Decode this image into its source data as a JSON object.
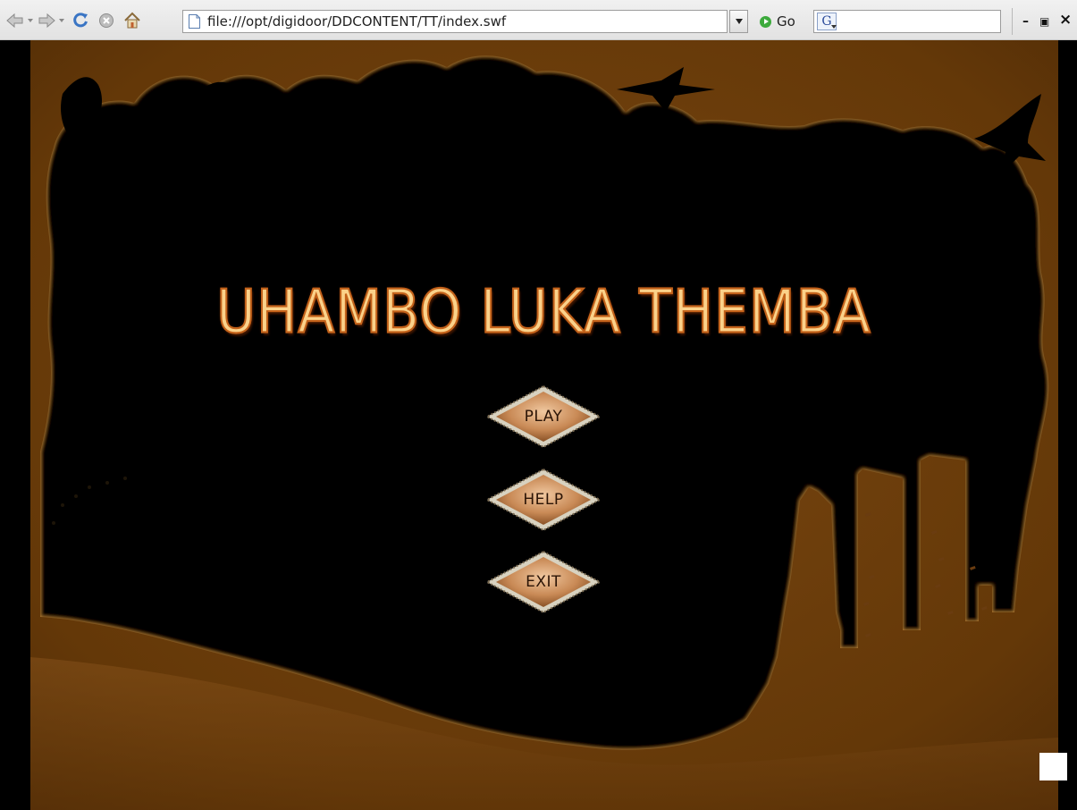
{
  "browser": {
    "url": "file:///opt/digidoor/DDCONTENT/TT/index.swf",
    "go_label": "Go",
    "search_engine_letter": "G",
    "search_value": "",
    "window_controls": {
      "minimize": "–",
      "restore": "▣",
      "close": "×"
    }
  },
  "game": {
    "title": "UHAMBO LUKA THEMBA",
    "menu": {
      "play": "PLAY",
      "help": "HELP",
      "exit": "EXIT"
    }
  },
  "colors": {
    "ground": "#6b3c0c",
    "frame_border": "#a0601c",
    "title_fill": "#fbd28a",
    "title_outline": "#c4621a",
    "button_face": "#c98a56",
    "button_text": "#2b1406"
  },
  "icons": [
    "back-icon",
    "forward-icon",
    "reload-icon",
    "stop-icon",
    "home-icon",
    "page-icon",
    "go-icon",
    "search-engine-icon"
  ]
}
